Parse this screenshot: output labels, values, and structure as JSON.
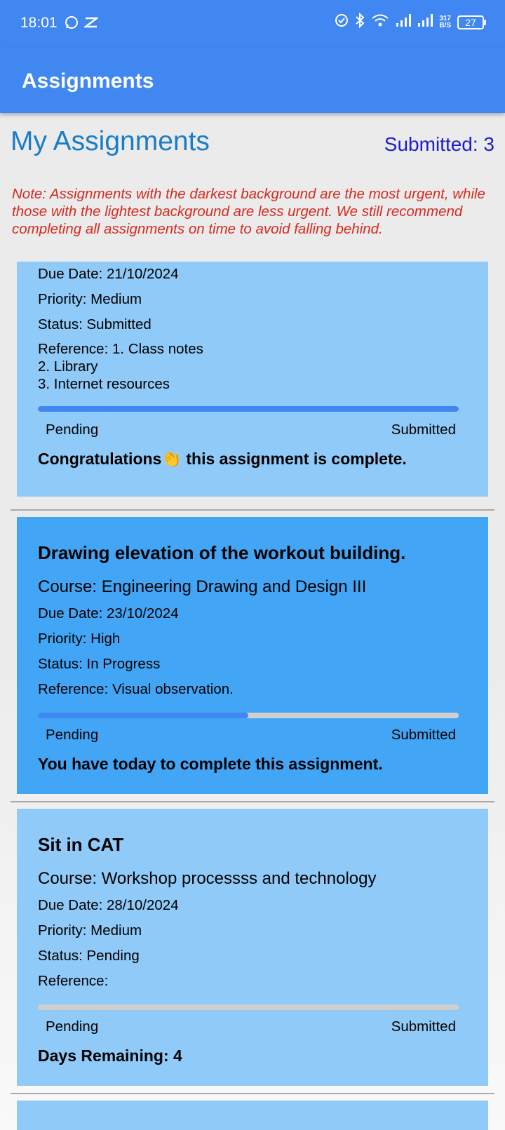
{
  "status_bar": {
    "time": "18:01",
    "speed_top": "317",
    "speed_bottom": "B/S",
    "battery": "27"
  },
  "app_bar": {
    "title": "Assignments"
  },
  "header": {
    "title": "My Assignments",
    "submitted": "Submitted: 3"
  },
  "note": "Note: Assignments with the darkest background are the most urgent, while those with the lightest background are less urgent. We still recommend completing all assignments on time to avoid falling behind.",
  "assignments": [
    {
      "due": "Due Date: 21/10/2024",
      "priority": "Priority: Medium",
      "status": "Status: Submitted",
      "reference": "Reference: 1. Class notes\n2. Library\n3. Internet resources",
      "progress": 1.0,
      "pending_label": "Pending",
      "submitted_label": "Submitted",
      "message_before": "Congratulations",
      "message_emoji": "👏",
      "message_after": " this assignment is complete."
    },
    {
      "title": "Drawing elevation of the workout building.",
      "course": "Course: Engineering Drawing and Design III",
      "due": "Due Date: 23/10/2024",
      "priority": "Priority: High",
      "status": "Status: In Progress",
      "reference": "Reference: Visual observation.",
      "progress": 0.5,
      "pending_label": "Pending",
      "submitted_label": "Submitted",
      "message": "You have today to complete this assignment."
    },
    {
      "title": "Sit in CAT",
      "course": "Course: Workshop processss and technology",
      "due": "Due Date: 28/10/2024",
      "priority": "Priority: Medium",
      "status": "Status: Pending",
      "reference": "Reference:",
      "progress": 0.0,
      "pending_label": "Pending",
      "submitted_label": "Submitted",
      "message": "Days Remaining: 4"
    }
  ],
  "colors": {
    "urgent": "#42a5f5",
    "normal": "#90caf8",
    "accent": "#4187f2"
  }
}
